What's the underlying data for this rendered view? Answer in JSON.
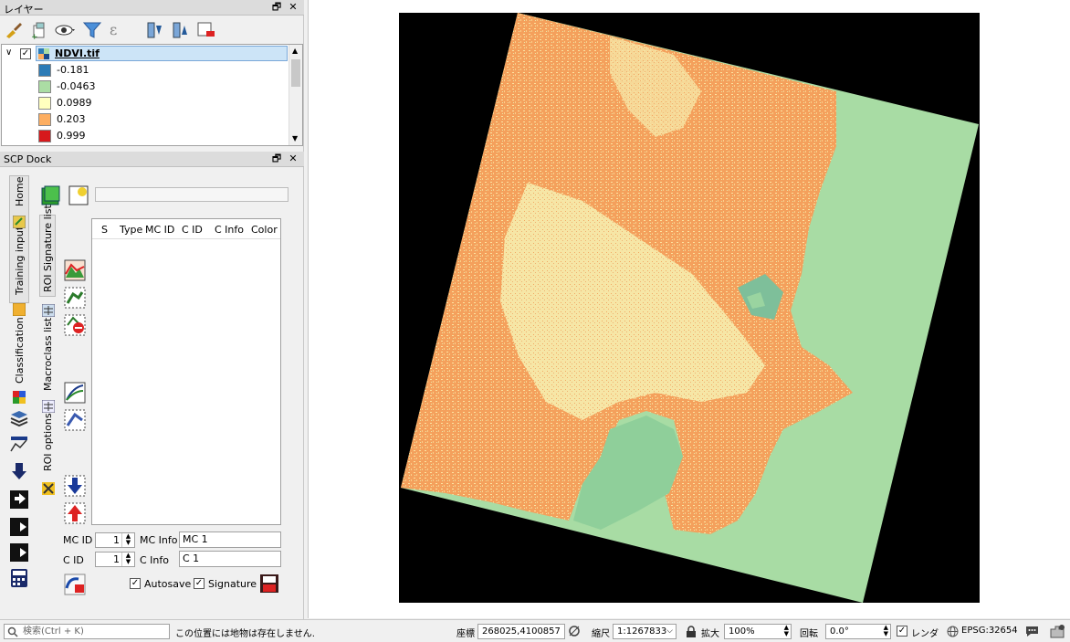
{
  "layers_panel": {
    "title": "レイヤー",
    "float_btn": "🗗",
    "close_btn": "✕",
    "layer_name": "NDVI.tif",
    "legend": [
      {
        "label": "-0.181",
        "color": "#2c7bb6"
      },
      {
        "label": "-0.0463",
        "color": "#abdda4"
      },
      {
        "label": "0.0989",
        "color": "#ffffbf"
      },
      {
        "label": "0.203",
        "color": "#fdae61"
      },
      {
        "label": "0.999",
        "color": "#d7191c"
      }
    ]
  },
  "scp_dock": {
    "title": "SCP Dock",
    "tabs": [
      "Home",
      "Training input",
      "Classification"
    ],
    "subtabs": [
      "ROI Signature list",
      "Macroclass list",
      "ROI options"
    ],
    "table_headers": [
      "S",
      "Type",
      "MC ID",
      "C ID",
      "C Info",
      "Color"
    ],
    "mc_id_label": "MC ID",
    "mc_id_value": "1",
    "mc_info_label": "MC Info",
    "mc_info_value": "MC 1",
    "c_id_label": "C ID",
    "c_id_value": "1",
    "c_info_label": "C Info",
    "c_info_value": "C 1",
    "autosave_label": "Autosave",
    "signature_label": "Signature"
  },
  "status_bar": {
    "search_placeholder": "検索(Ctrl + K)",
    "message": "この位置には地物は存在しません.",
    "coord_label": "座標",
    "coord_value": "268025,4100857",
    "scale_label": "縮尺",
    "scale_value": "1:1267833",
    "magnify_label": "拡大",
    "magnify_value": "100%",
    "rotation_label": "回転",
    "rotation_value": "0.0°",
    "render_label": "レンダ",
    "crs_label": "EPSG:32654"
  }
}
